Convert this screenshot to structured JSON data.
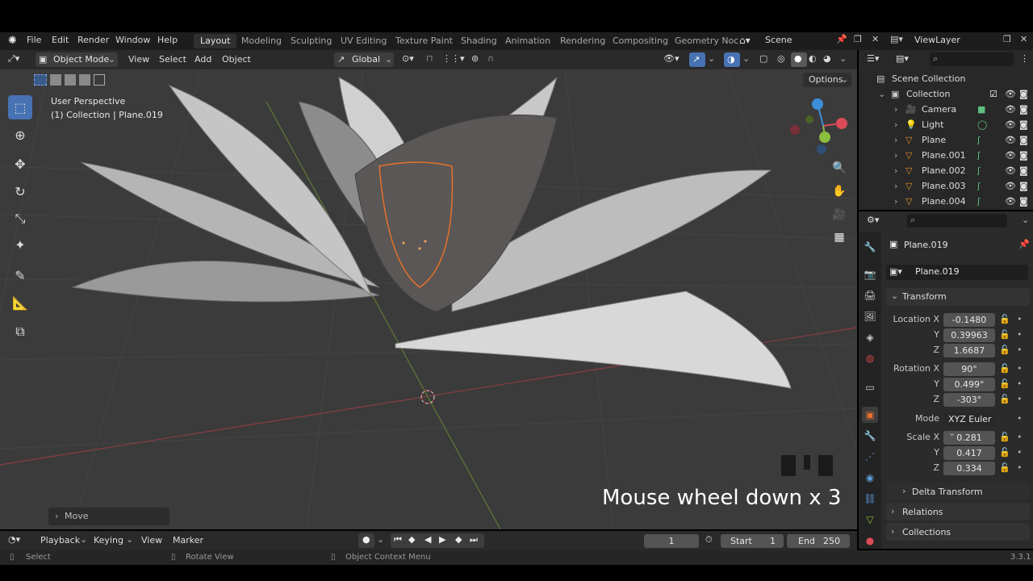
{
  "menu": [
    "File",
    "Edit",
    "Render",
    "Window",
    "Help"
  ],
  "workspaces": [
    "Layout",
    "Modeling",
    "Sculpting",
    "UV Editing",
    "Texture Paint",
    "Shading",
    "Animation",
    "Rendering",
    "Compositing",
    "Geometry Noc"
  ],
  "scene": {
    "label": "Scene"
  },
  "view_layer": {
    "label": "ViewLayer"
  },
  "viewport_header": {
    "mode": "Object Mode",
    "menus": [
      "View",
      "Select",
      "Add",
      "Object"
    ],
    "orientation": "Global",
    "options": "Options"
  },
  "viewport": {
    "perspective": "User Perspective",
    "collection_info": "(1) Collection | Plane.019",
    "operator_panel": "Move",
    "overlay_caption": "Mouse wheel down x 3"
  },
  "outliner": {
    "root": "Scene Collection",
    "collection": "Collection",
    "items": [
      {
        "name": "Camera",
        "icon": "camera-icon"
      },
      {
        "name": "Light",
        "icon": "light-icon"
      },
      {
        "name": "Plane",
        "icon": "mesh-icon"
      },
      {
        "name": "Plane.001",
        "icon": "mesh-icon"
      },
      {
        "name": "Plane.002",
        "icon": "mesh-icon"
      },
      {
        "name": "Plane.003",
        "icon": "mesh-icon"
      },
      {
        "name": "Plane.004",
        "icon": "mesh-icon"
      }
    ]
  },
  "properties": {
    "object_name": "Plane.019",
    "datablock": "Plane.019",
    "transform_title": "Transform",
    "location": {
      "label_x": "Location X",
      "label_y": "Y",
      "label_z": "Z",
      "x": "-0.1480",
      "y": "0.39963",
      "z": "1.6687"
    },
    "rotation": {
      "label_x": "Rotation X",
      "label_y": "Y",
      "label_z": "Z",
      "x": "90°",
      "y": "0.499°",
      "z": "-303°"
    },
    "mode": {
      "label": "Mode",
      "value": "XYZ Euler"
    },
    "scale": {
      "label_x": "Scale X",
      "label_y": "Y",
      "label_z": "Z",
      "x": "0.281",
      "y": "0.417",
      "z": "0.334"
    },
    "delta": "Delta Transform",
    "relations": "Relations",
    "collections": "Collections"
  },
  "timeline": {
    "playback": "Playback",
    "keying": "Keying",
    "view": "View",
    "marker": "Marker",
    "current_frame": "1",
    "start_label": "Start",
    "start": "1",
    "end_label": "End",
    "end": "250"
  },
  "status": {
    "select": "Select",
    "rotate": "Rotate View",
    "context": "Object Context Menu",
    "version": "3.3.1"
  },
  "colors": {
    "accent": "#4772b3",
    "selection": "#e8702a",
    "x_axis": "#d94b57",
    "y_axis": "#8bbd3f",
    "z_axis": "#3d8fd9"
  }
}
